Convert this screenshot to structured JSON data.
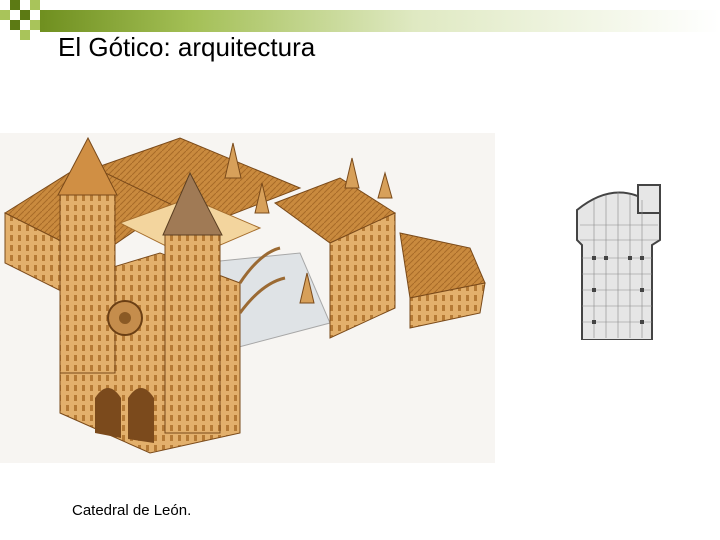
{
  "slide": {
    "title": "El Gótico: arquitectura",
    "caption": "Catedral de León."
  },
  "images": {
    "cathedral": "cutaway-illustration-of-leon-cathedral",
    "floor_plan": "cathedral-floor-plan"
  },
  "theme": {
    "accent_dark": "#5c7a14",
    "accent_light": "#a9c45a",
    "stone": "#d9a35a"
  }
}
